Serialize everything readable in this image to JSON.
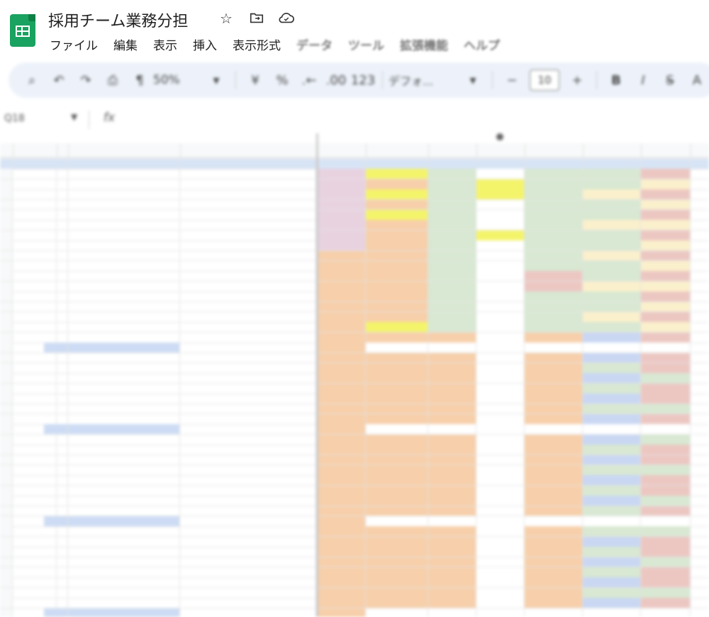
{
  "doc": {
    "title": "採用チーム業務分担"
  },
  "icons": {
    "app": "google-sheets-logo",
    "star": "star-icon",
    "move": "move-to-folder-icon",
    "cloud": "cloud-sync-icon"
  },
  "menu": {
    "file": "ファイル",
    "edit": "編集",
    "view": "表示",
    "insert": "挿入",
    "format": "表示形式",
    "data": "データ",
    "tools": "ツール",
    "extensions": "拡張機能",
    "help": "ヘルプ"
  },
  "toolbar": {
    "zoom": "50%",
    "currency": "¥",
    "percent": "%",
    "number_format": "123",
    "font": "デフォ...",
    "font_size": "10",
    "bold": "B",
    "italic": "I"
  },
  "formula_bar": {
    "cell_ref": "Q18",
    "fx": "fx"
  },
  "colors": {
    "pink": "#e8d2e0",
    "orange": "#f7cfaa",
    "green": "#d8e8d2",
    "yellow": "#f4f46a",
    "cream": "#fbf0cc",
    "blue": "#c9d7f3",
    "red": "#ecc7c2",
    "section_blue": "#cddcf4",
    "header_blue": "#d7e4f5"
  }
}
